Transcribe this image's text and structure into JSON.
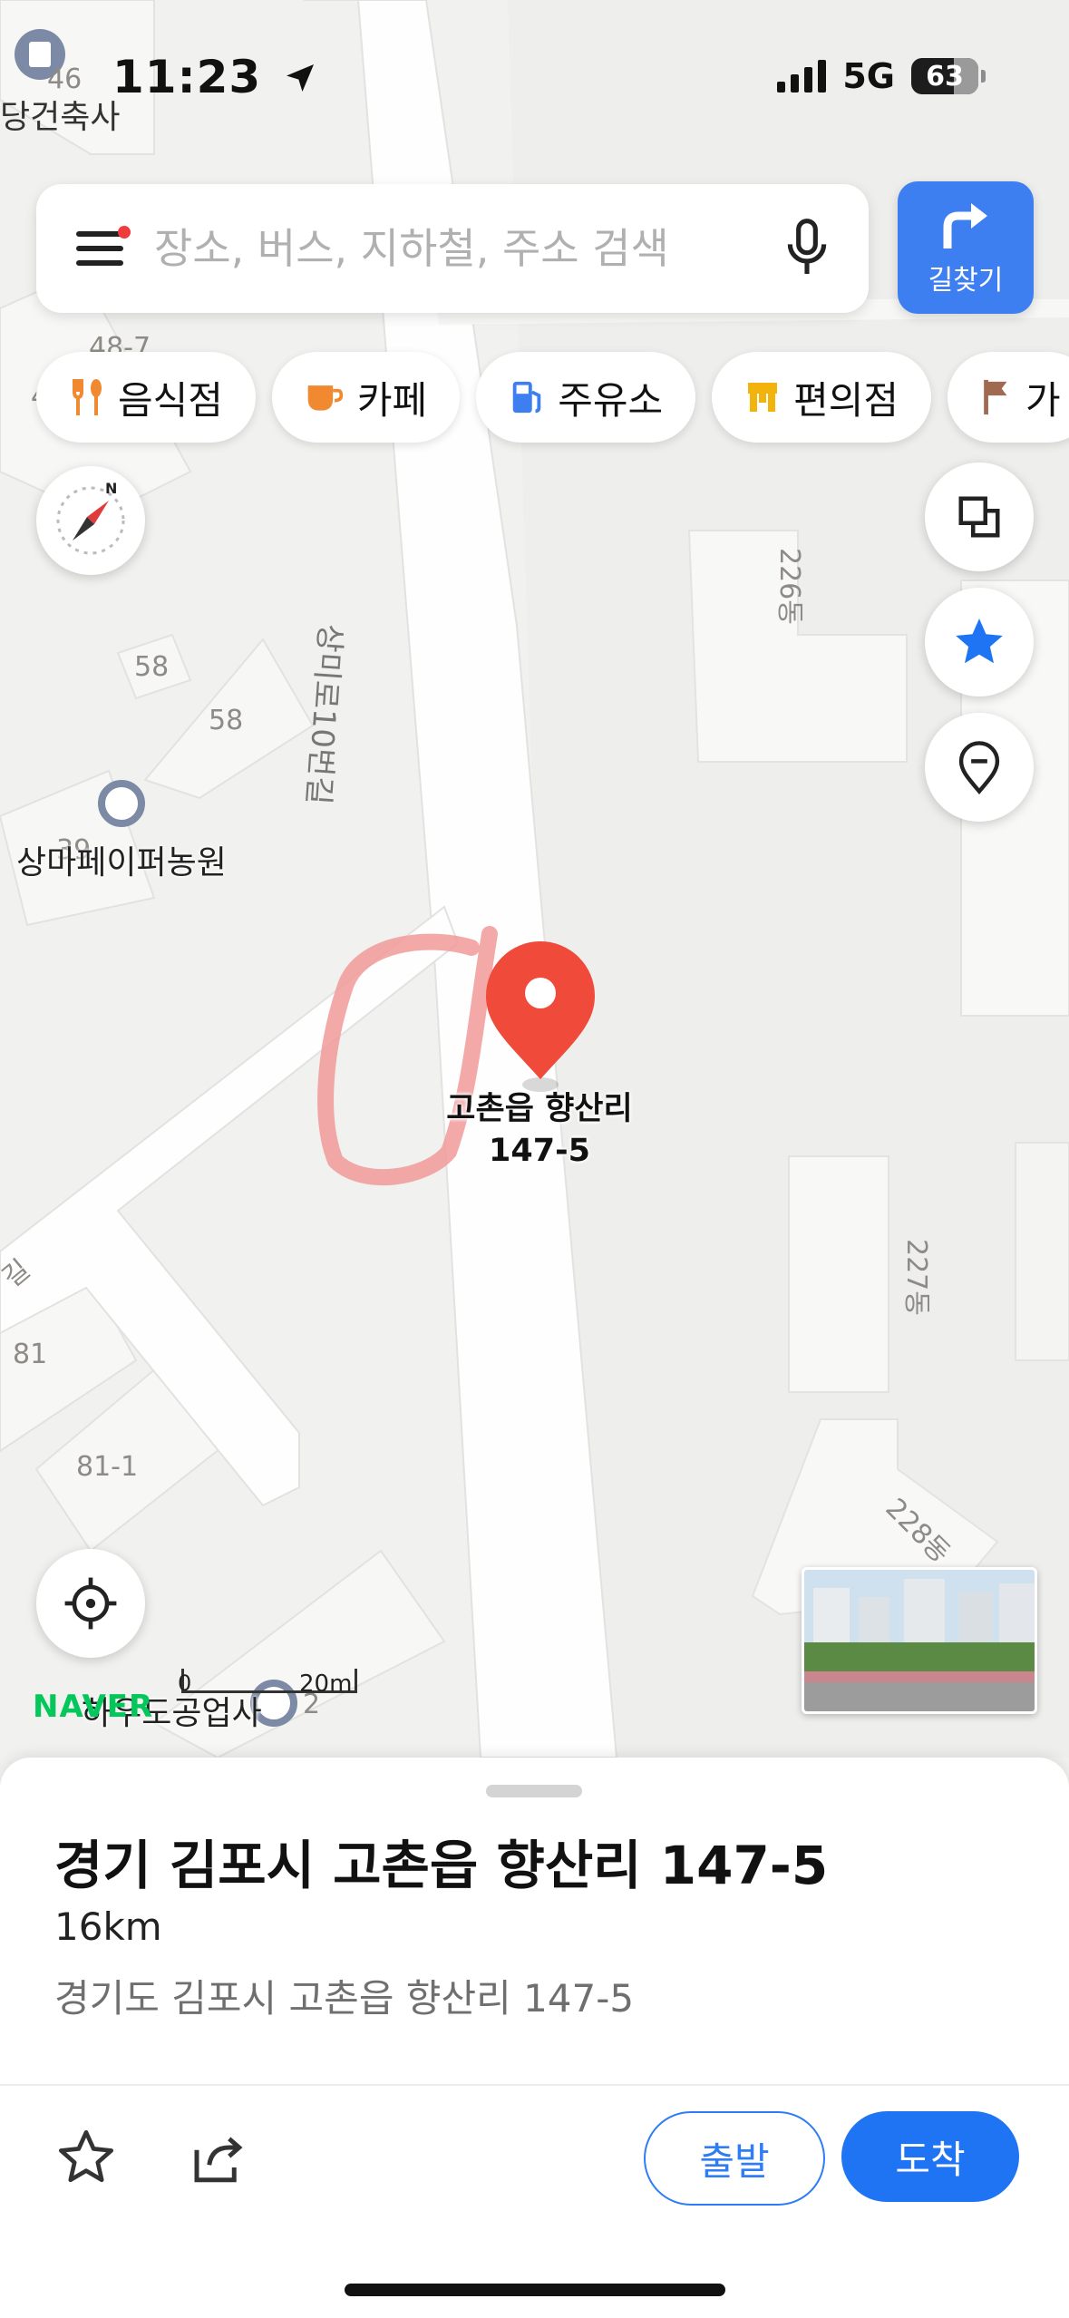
{
  "status_bar": {
    "time": "11:23",
    "network": "5G",
    "battery": "63",
    "battery_level": 0.63
  },
  "search": {
    "placeholder": "장소, 버스, 지하철, 주소 검색",
    "route_label": "길찾기"
  },
  "categories": [
    {
      "label": "음식점",
      "icon": "fork-spoon-icon",
      "color": "#f0892f"
    },
    {
      "label": "카페",
      "icon": "coffee-cup-icon",
      "color": "#f0892f"
    },
    {
      "label": "주유소",
      "icon": "fuel-pump-icon",
      "color": "#3d7ff0"
    },
    {
      "label": "편의점",
      "icon": "store-icon",
      "color": "#f2b40c"
    },
    {
      "label": "가",
      "icon": "flag-icon",
      "color": "#a06a50"
    }
  ],
  "map": {
    "labels": {
      "building_top": "당건축사",
      "lot_46": "46",
      "lot_48_7": "48-7",
      "lot_4": "4",
      "road": "상미로10번길",
      "lot_58a": "58",
      "lot_58b": "58",
      "poi_paper_farm": "상마페이퍼농원",
      "lot_39": "39",
      "bldg_226": "226동",
      "bldg_227": "227동",
      "bldg_228": "228동",
      "road_fragment": "길",
      "lot_81": "81",
      "lot_81_1": "81-1",
      "poi_industry": "하우도공업사",
      "lot_2": "2"
    },
    "pin_label_line1": "고촌읍 향산리",
    "pin_label_line2": "147-5",
    "brand": "NAVER",
    "scale_zero": "0",
    "scale_distance": "20m",
    "accent_color": "#f04a3a"
  },
  "place": {
    "title": "경기 김포시 고촌읍 향산리 147-5",
    "distance": "16km",
    "address": "경기도 김포시 고촌읍 향산리 147-5"
  },
  "actions": {
    "start_label": "출발",
    "arrive_label": "도착"
  }
}
